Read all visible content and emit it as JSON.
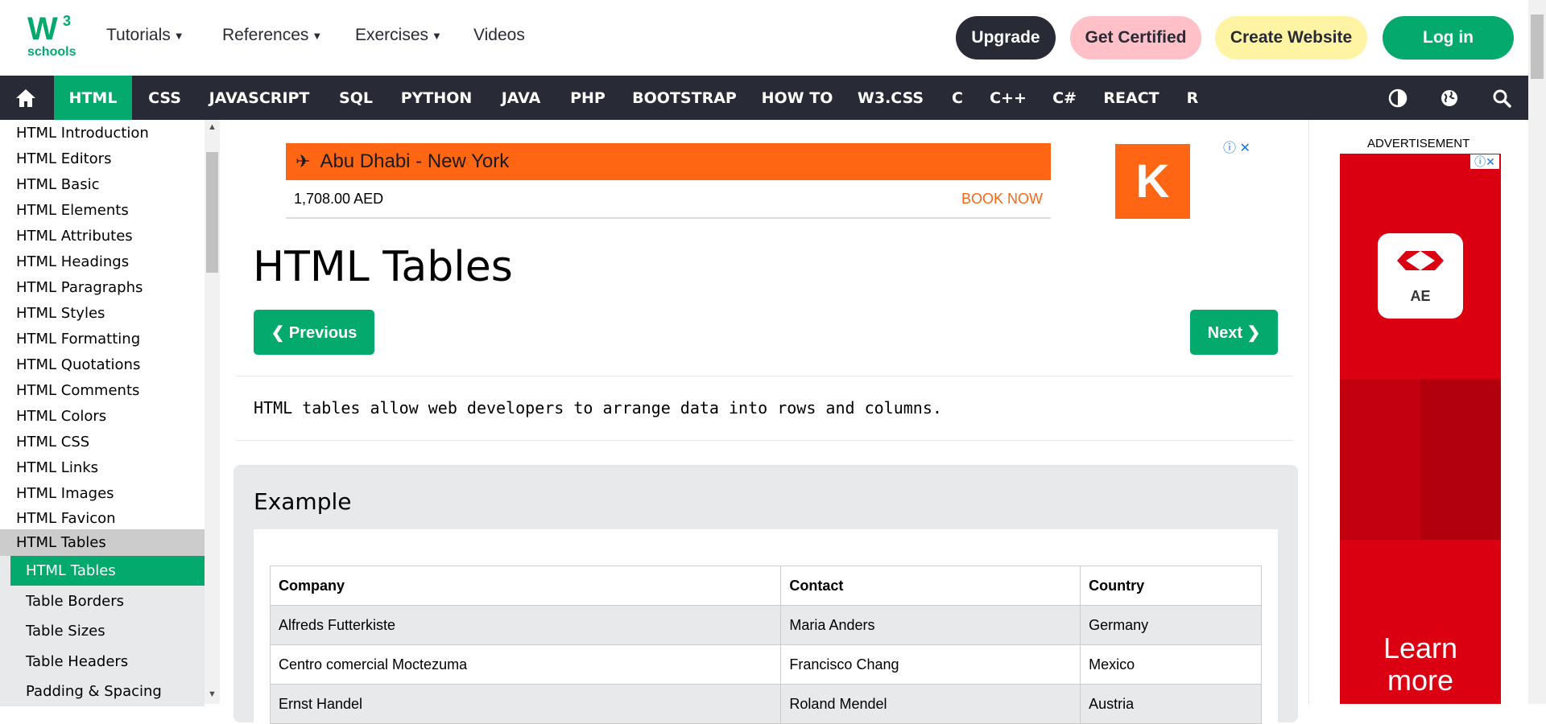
{
  "header": {
    "logo_text": "W",
    "logo_sup": "3",
    "logo_sub": "schools",
    "nav": [
      {
        "label": "Tutorials",
        "caret": "▼"
      },
      {
        "label": "References",
        "caret": "▼"
      },
      {
        "label": "Exercises",
        "caret": "▼"
      },
      {
        "label": "Videos"
      }
    ],
    "buttons": {
      "upgrade": "Upgrade",
      "certified": "Get Certified",
      "create_website": "Create Website",
      "login": "Log in"
    }
  },
  "subnav": {
    "items": [
      "HTML",
      "CSS",
      "JAVASCRIPT",
      "SQL",
      "PYTHON",
      "JAVA",
      "PHP",
      "BOOTSTRAP",
      "HOW TO",
      "W3.CSS",
      "C",
      "C++",
      "C#",
      "REACT",
      "R"
    ],
    "active": "HTML",
    "icons": [
      "home-icon",
      "contrast-icon",
      "globe-icon",
      "search-icon"
    ]
  },
  "sidebar": {
    "items": [
      "HTML Introduction",
      "HTML Editors",
      "HTML Basic",
      "HTML Elements",
      "HTML Attributes",
      "HTML Headings",
      "HTML Paragraphs",
      "HTML Styles",
      "HTML Formatting",
      "HTML Quotations",
      "HTML Comments",
      "HTML Colors",
      "HTML CSS",
      "HTML Links",
      "HTML Images",
      "HTML Favicon"
    ],
    "group": "HTML Tables",
    "sub_items": [
      "HTML Tables",
      "Table Borders",
      "Table Sizes",
      "Table Headers",
      "Padding & Spacing"
    ],
    "current": "HTML Tables"
  },
  "ad_banner": {
    "route": "Abu Dhabi - New York",
    "price": "1,708.00 AED",
    "cta": "BOOK NOW",
    "brand_letter": "K"
  },
  "main": {
    "title": "HTML Tables",
    "prev_label": "❮ Previous",
    "next_label": "Next ❯",
    "intro": "HTML tables allow web developers to arrange data into rows and columns.",
    "example_title": "Example",
    "table": {
      "headers": [
        "Company",
        "Contact",
        "Country"
      ],
      "rows": [
        [
          "Alfreds Futterkiste",
          "Maria Anders",
          "Germany"
        ],
        [
          "Centro comercial Moctezuma",
          "Francisco Chang",
          "Mexico"
        ],
        [
          "Ernst Handel",
          "Roland Mendel",
          "Austria"
        ]
      ]
    }
  },
  "right_ad": {
    "label": "ADVERTISEMENT",
    "logo_caption": "AE",
    "cta": "Learn more"
  },
  "colors": {
    "accent": "#04AA6D",
    "dark": "#282A35",
    "upgrade_bg": "#282A35",
    "certified_bg": "#FFC0C7",
    "create_bg": "#FFF4A3"
  }
}
